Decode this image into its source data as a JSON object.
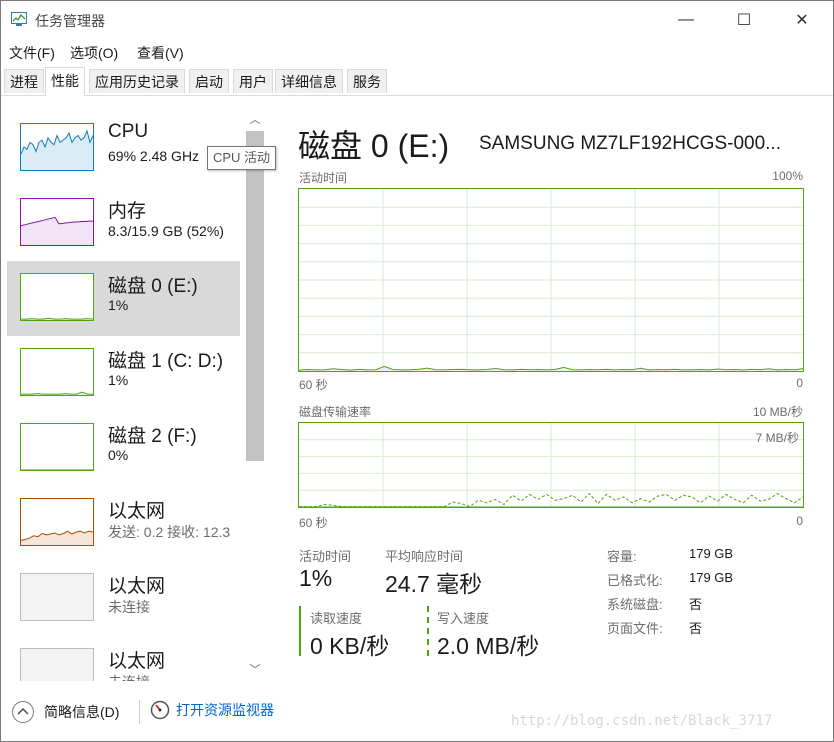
{
  "window": {
    "title": "任务管理器",
    "app_icon": "task-manager-icon",
    "controls": {
      "minimize": "—",
      "maximize": "☐",
      "close": "✕"
    }
  },
  "menu": [
    {
      "label": "文件(F)"
    },
    {
      "label": "选项(O)"
    },
    {
      "label": "查看(V)"
    }
  ],
  "tabs": [
    {
      "label": "进程",
      "active": false
    },
    {
      "label": "性能",
      "active": true
    },
    {
      "label": "应用历史记录",
      "active": false
    },
    {
      "label": "启动",
      "active": false
    },
    {
      "label": "用户",
      "active": false
    },
    {
      "label": "详细信息",
      "active": false
    },
    {
      "label": "服务",
      "active": false
    }
  ],
  "resources": [
    {
      "name": "CPU",
      "sub": "69%  2.48 GHz",
      "color": "#117dbb",
      "selected": false
    },
    {
      "name": "内存",
      "sub": "8.3/15.9 GB (52%)",
      "color": "#8b12ae",
      "selected": false
    },
    {
      "name": "磁盘 0 (E:)",
      "sub": "1%",
      "color": "#4da60c",
      "selected": true
    },
    {
      "name": "磁盘 1 (C: D:)",
      "sub": "1%",
      "color": "#4da60c",
      "selected": false
    },
    {
      "name": "磁盘 2 (F:)",
      "sub": "0%",
      "color": "#4da60c",
      "selected": false
    },
    {
      "name": "以太网",
      "sub": "发送: 0.2  接收: 12.3",
      "color": "#a74f01",
      "selected": false
    },
    {
      "name": "以太网",
      "sub": "未连接",
      "color": "#a0a0a0",
      "selected": false
    },
    {
      "name": "以太网",
      "sub": "未连接",
      "color": "#a0a0a0",
      "selected": false
    }
  ],
  "tooltip": "CPU 活动",
  "disk": {
    "title": "磁盘 0 (E:)",
    "model": "SAMSUNG MZ7LF192HCGS-000...",
    "activity_graph": {
      "label": "活动时间",
      "max_label": "100%",
      "left_time": "60 秒",
      "right_time": "0",
      "percent_values": [
        0.5,
        0.8,
        0.6,
        0.7,
        1.2,
        0.8,
        0.5,
        0.9,
        0.6,
        0.7,
        2.5,
        0.8,
        0.6,
        0.7,
        0.9,
        1.6,
        0.7,
        0.6,
        0.8,
        0.9,
        0.7,
        0.6,
        0.8,
        1.4,
        0.7,
        0.6,
        0.9,
        0.7,
        0.8,
        0.6,
        0.9,
        2.0,
        0.7,
        0.6,
        0.8,
        0.7,
        0.9,
        0.6,
        0.8,
        0.7,
        1.5,
        0.6,
        0.8,
        0.7,
        0.9,
        0.6,
        0.7,
        0.8,
        0.6,
        1.1,
        0.7,
        0.8,
        0.6,
        0.9,
        0.7,
        1.2,
        0.6,
        0.8,
        0.7,
        1.3
      ]
    },
    "transfer_graph": {
      "label": "磁盘传输速率",
      "max_label": "10 MB/秒",
      "inner_label": "7 MB/秒",
      "left_time": "60 秒",
      "right_time": "0",
      "write_mb": [
        0.05,
        0.05,
        0.05,
        0.3,
        0.2,
        0.05,
        0.05,
        0.05,
        0.05,
        0.05,
        0.05,
        0.05,
        0.05,
        0.05,
        0.05,
        0.05,
        0.05,
        0.05,
        0.6,
        0.4,
        0.05,
        0.8,
        0.5,
        0.9,
        0.3,
        1.4,
        0.7,
        1.5,
        0.9,
        1.5,
        0.8,
        1.0,
        1.4,
        0.6,
        1.6,
        0.4,
        1.5,
        0.8,
        1.2,
        0.5,
        1.0,
        0.6,
        1.3,
        1.5,
        0.8,
        1.4,
        1.2,
        0.5,
        1.3,
        0.7,
        1.5,
        0.9,
        0.5,
        1.4,
        0.7,
        0.9,
        1.6,
        1.0,
        0.5,
        1.2
      ],
      "read_mb": [
        0.0,
        0.0,
        0.0,
        0.0,
        0.0,
        0.0,
        0.0,
        0.0,
        0.0,
        0.0,
        0.0,
        0.0,
        0.0,
        0.0,
        0.0,
        0.0,
        0.0,
        0.0,
        0.0,
        0.0,
        0.0,
        0.0,
        0.0,
        0.0,
        0.0,
        0.0,
        0.0,
        0.0,
        0.0,
        0.0,
        0.0,
        0.0,
        0.0,
        0.0,
        0.0,
        0.0,
        0.0,
        0.0,
        0.0,
        0.0,
        0.0,
        0.0,
        0.0,
        0.0,
        0.0,
        0.0,
        0.0,
        0.0,
        0.0,
        0.0,
        0.0,
        0.0,
        0.0,
        0.0,
        0.0,
        0.0,
        0.0,
        0.0,
        0.0,
        0.0
      ]
    },
    "stats": {
      "active_time_label": "活动时间",
      "active_time": "1%",
      "avg_response_label": "平均响应时间",
      "avg_response": "24.7 毫秒",
      "read_speed_label": "读取速度",
      "read_speed": "0 KB/秒",
      "write_speed_label": "写入速度",
      "write_speed": "2.0 MB/秒"
    },
    "props": [
      {
        "label": "容量:",
        "value": "179 GB"
      },
      {
        "label": "已格式化:",
        "value": "179 GB"
      },
      {
        "label": "系统磁盘:",
        "value": "否"
      },
      {
        "label": "页面文件:",
        "value": "否"
      }
    ]
  },
  "footer": {
    "less_details": "简略信息(D)",
    "open_monitor": "打开资源监视器"
  },
  "watermark": "http://blog.csdn.net/Black_3717",
  "colors": {
    "disk_green": "#4da60c",
    "cpu_blue": "#117dbb",
    "memory_purple": "#8b12ae",
    "ethernet_brown": "#a74f01",
    "link_blue": "#0066cc"
  }
}
